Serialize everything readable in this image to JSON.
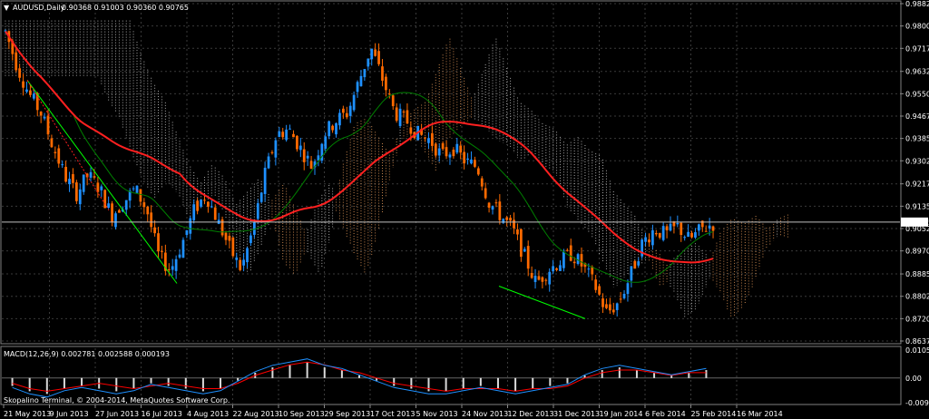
{
  "header": {
    "arrow": "▼",
    "symbol": "AUDUSD,Daily",
    "ohlc": "0.90368 0.91003 0.90360 0.90765"
  },
  "colors": {
    "background": "#000000",
    "grid": "#3a3a3a",
    "bull": "#1e90ff",
    "bear": "#ff6a00",
    "ma_fast": "#008000",
    "ma_slow": "#ff2020",
    "cloud_up": "#f4a460",
    "cloud_down": "#d3d3d3",
    "macd_signal": "#ff0000",
    "macd_hist": "#ffffff",
    "price_line": "#c0c0c0",
    "trend_green": "#00ff00"
  },
  "chart_data": {
    "type": "candlestick",
    "symbol": "AUDUSD",
    "timeframe": "Daily",
    "current_price": "0.90765",
    "price_axis_labels": [
      "0.98825",
      "0.98000",
      "0.97175",
      "0.96325",
      "0.95500",
      "0.94675",
      "0.93850",
      "0.93025",
      "0.92175",
      "0.91350",
      "0.90525",
      "0.89700",
      "0.88850",
      "0.88025",
      "0.87200",
      "0.86375"
    ],
    "ylim": [
      0.86375,
      0.98825
    ],
    "date_labels": [
      "21 May 2013",
      "9 Jun 2013",
      "27 Jun 2013",
      "16 Jul 2013",
      "4 Aug 2013",
      "22 Aug 2013",
      "10 Sep 2013",
      "29 Sep 2013",
      "17 Oct 2013",
      "5 Nov 2013",
      "24 Nov 2013",
      "12 Dec 2013",
      "31 Dec 2013",
      "19 Jan 2014",
      "6 Feb 2014",
      "25 Feb 2014",
      "16 Mar 2014"
    ],
    "close_path": [
      0.978,
      0.965,
      0.955,
      0.948,
      0.936,
      0.925,
      0.918,
      0.925,
      0.92,
      0.91,
      0.915,
      0.92,
      0.912,
      0.895,
      0.89,
      0.9,
      0.912,
      0.918,
      0.908,
      0.898,
      0.89,
      0.905,
      0.925,
      0.94,
      0.942,
      0.935,
      0.928,
      0.94,
      0.945,
      0.948,
      0.96,
      0.972,
      0.96,
      0.948,
      0.945,
      0.94,
      0.938,
      0.932,
      0.935,
      0.93,
      0.928,
      0.915,
      0.91,
      0.905,
      0.895,
      0.885,
      0.89,
      0.893,
      0.896,
      0.891,
      0.884,
      0.874,
      0.878,
      0.888,
      0.9,
      0.905,
      0.903,
      0.906,
      0.901,
      0.905,
      0.907
    ],
    "macd": {
      "label": "MACD(12,26,9) 0.002781 0.002588 0.000193",
      "axis_labels": [
        "0.010535",
        "0.00",
        "-0.009306"
      ],
      "hist": [
        -0.003,
        -0.005,
        -0.006,
        -0.004,
        -0.003,
        -0.004,
        -0.005,
        -0.004,
        -0.002,
        -0.003,
        -0.004,
        -0.005,
        -0.004,
        -0.001,
        0.002,
        0.004,
        0.005,
        0.006,
        0.004,
        0.003,
        0.001,
        -0.001,
        -0.003,
        -0.004,
        -0.005,
        -0.005,
        -0.004,
        -0.003,
        -0.004,
        -0.005,
        -0.004,
        -0.003,
        -0.002,
        0.001,
        0.003,
        0.004,
        0.003,
        0.002,
        0.001,
        0.002,
        0.003
      ],
      "signal": [
        -0.002,
        -0.004,
        -0.005,
        -0.004,
        -0.003,
        -0.002,
        -0.003,
        -0.004,
        -0.003,
        -0.002,
        -0.003,
        -0.004,
        -0.004,
        -0.002,
        0.001,
        0.003,
        0.005,
        0.006,
        0.005,
        0.003,
        0.002,
        0.0,
        -0.002,
        -0.003,
        -0.004,
        -0.005,
        -0.004,
        -0.004,
        -0.004,
        -0.005,
        -0.004,
        -0.004,
        -0.003,
        0.0,
        0.002,
        0.003,
        0.003,
        0.002,
        0.001,
        0.002,
        0.002
      ]
    }
  },
  "footer": {
    "copyright": "Skopalino Terminal, © 2004-2014, MetaQuotes Software Corp."
  }
}
